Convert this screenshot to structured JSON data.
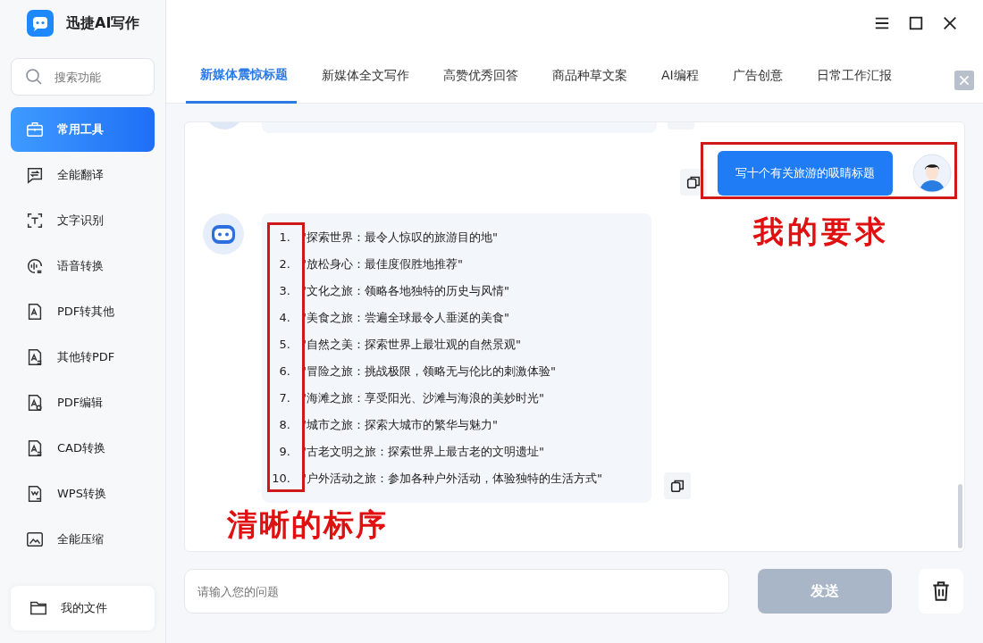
{
  "app": {
    "title": "迅捷AI写作"
  },
  "sidebar": {
    "search": {
      "placeholder": "搜索功能"
    },
    "items": [
      {
        "label": "常用工具",
        "kind": "toolbox",
        "selected": true
      },
      {
        "label": "全能翻译",
        "kind": "translate",
        "selected": false
      },
      {
        "label": "文字识别",
        "kind": "ocr",
        "selected": false
      },
      {
        "label": "语音转换",
        "kind": "voice",
        "selected": false
      },
      {
        "label": "PDF转其他",
        "kind": "doc",
        "selected": false
      },
      {
        "label": "其他转PDF",
        "kind": "swap",
        "selected": false
      },
      {
        "label": "PDF编辑",
        "kind": "edit",
        "selected": false
      },
      {
        "label": "CAD转换",
        "kind": "swap",
        "selected": false
      },
      {
        "label": "WPS转换",
        "kind": "wps",
        "selected": false
      },
      {
        "label": "全能压缩",
        "kind": "compress",
        "selected": false
      }
    ],
    "footer": {
      "label": "我的文件"
    }
  },
  "tabs": [
    {
      "label": "新媒体震惊标题",
      "selected": true
    },
    {
      "label": "新媒体全文写作",
      "selected": false
    },
    {
      "label": "高赞优秀回答",
      "selected": false
    },
    {
      "label": "商品种草文案",
      "selected": false
    },
    {
      "label": "AI编程",
      "selected": false
    },
    {
      "label": "广告创意",
      "selected": false
    },
    {
      "label": "日常工作汇报",
      "selected": false
    }
  ],
  "chat": {
    "user_message": "写十个有关旅游的吸睛标题",
    "bot_reply": [
      {
        "number": "1.",
        "text": "\"探索世界：最令人惊叹的旅游目的地\""
      },
      {
        "number": "2.",
        "text": "\"放松身心：最佳度假胜地推荐\""
      },
      {
        "number": "3.",
        "text": "\"文化之旅：领略各地独特的历史与风情\""
      },
      {
        "number": "4.",
        "text": "\"美食之旅：尝遍全球最令人垂涎的美食\""
      },
      {
        "number": "5.",
        "text": "\"自然之美：探索世界上最壮观的自然景观\""
      },
      {
        "number": "6.",
        "text": "\"冒险之旅：挑战极限，领略无与伦比的刺激体验\""
      },
      {
        "number": "7.",
        "text": "\"海滩之旅：享受阳光、沙滩与海浪的美妙时光\""
      },
      {
        "number": "8.",
        "text": "\"城市之旅：探索大城市的繁华与魅力\""
      },
      {
        "number": "9.",
        "text": "\"古老文明之旅：探索世界上最古老的文明遗址\""
      },
      {
        "number": "10.",
        "text": "\"户外活动之旅：参加各种户外活动，体验独特的生活方式\""
      }
    ]
  },
  "input": {
    "placeholder": "请输入您的问题"
  },
  "send_button": {
    "label": "发送",
    "disabled": true
  },
  "annotations": [
    {
      "text": "我的要求"
    },
    {
      "text": "清晰的标序"
    }
  ]
}
